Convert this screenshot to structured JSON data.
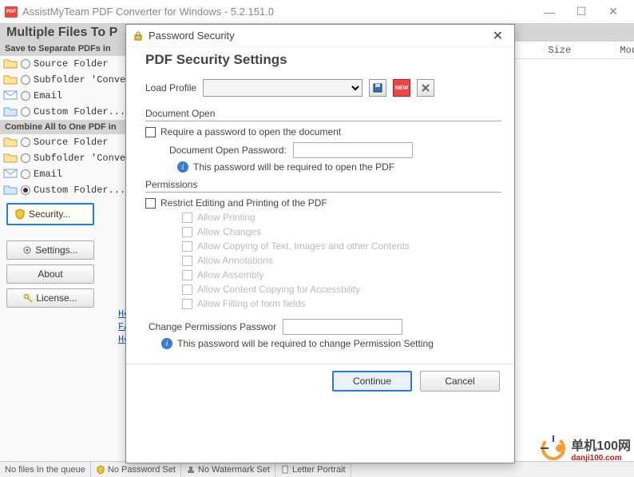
{
  "window": {
    "title": "AssistMyTeam PDF Converter for Windows - 5.2.151.0"
  },
  "header": {
    "title": "Multiple Files To P"
  },
  "left": {
    "section1_head": "Save to Separate PDFs in",
    "section1": [
      {
        "label": "Source Folder",
        "icon": "folder-orange",
        "checked": false
      },
      {
        "label": "Subfolder 'Conver",
        "icon": "folder-orange",
        "checked": false
      },
      {
        "label": "Email",
        "icon": "email",
        "checked": false
      },
      {
        "label": "Custom Folder...",
        "icon": "folder-blue",
        "checked": false
      }
    ],
    "section2_head": "Combine All to One PDF in",
    "section2": [
      {
        "label": "Source Folder",
        "icon": "folder-orange",
        "checked": false
      },
      {
        "label": "Subfolder 'Conver",
        "icon": "folder-orange",
        "checked": false
      },
      {
        "label": "Email",
        "icon": "email",
        "checked": false
      },
      {
        "label": "Custom Folder...",
        "icon": "folder-blue",
        "checked": true
      }
    ],
    "security_btn": "Security...",
    "settings_btn": "Settings...",
    "about_btn": "About",
    "license_btn": "License...",
    "links": [
      "Ho",
      "FA",
      "He"
    ]
  },
  "listview": {
    "cols": [
      "Size",
      "Modi"
    ]
  },
  "dialog": {
    "title": "Password Security",
    "heading": "PDF Security Settings",
    "load_profile_label": "Load Profile",
    "new_badge": "NEW",
    "doc_open": {
      "group": "Document Open",
      "require_label": "Require a password to open the document",
      "pwd_label": "Document Open Password:",
      "info": "This password will be required to open the PDF"
    },
    "perm": {
      "group": "Permissions",
      "restrict_label": "Restrict Editing and Printing of the PDF",
      "opts": [
        "Allow Printing",
        "Allow Changes",
        "Allow Copying of Text, Images and other Contents",
        "Allow Annotations",
        "Allow Assembly",
        "Allow Content Copying for Accessbility",
        "Allow Filling of form fields"
      ],
      "change_pwd_label": "Change Permissions Passwor",
      "info": "This password will be required to change Permission Setting"
    },
    "continue": "Continue",
    "cancel": "Cancel"
  },
  "status": {
    "files": "No files In the queue",
    "pwd": "No Password Set",
    "wm": "No Watermark Set",
    "orient": "Letter Portrait"
  },
  "wm": {
    "name": "单机100网",
    "url": "danji100.com"
  }
}
